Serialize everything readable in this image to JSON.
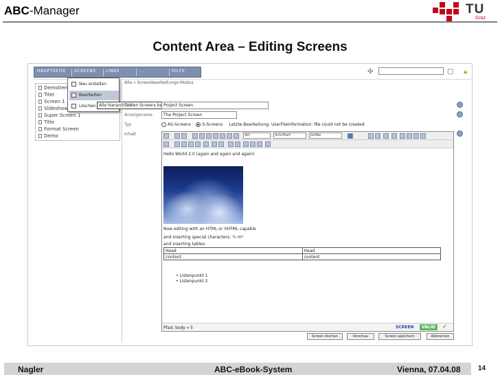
{
  "header": {
    "app_title_bold": "ABC",
    "app_title_rest": "-Manager",
    "logo_text": "TU",
    "logo_subtext": "Graz",
    "logo_color": "#c4001a"
  },
  "slide": {
    "title": "Content Area – Editing Screens"
  },
  "screenshot": {
    "menubar": [
      "HAUPTSEITE",
      "SCREENS",
      "LINKS",
      "...",
      "HILFE"
    ],
    "path": "Alle » Screenbearbeitungs-Modus",
    "left_list": [
      "Demoitem",
      "Titel",
      "Screen 1",
      "Slideshow",
      "Super Screen 1",
      "Title",
      "Format Screen",
      "Demo"
    ],
    "popup_menu": [
      "Neu erstellen",
      "Bearbeiten",
      "Löschen"
    ],
    "popup_tooltip": "Alle hierarchischen Screens bearbeiten",
    "fields": [
      {
        "label": "Titel",
        "value": "Project Screen"
      },
      {
        "label": "Anzeigename",
        "value": "The Project Screen"
      },
      {
        "label": "Typ",
        "value": ""
      },
      {
        "label": "Inhalt",
        "value": ""
      }
    ],
    "radio_options": [
      "AS-Screens",
      "S-Screens"
    ],
    "radio_note": "Letzte Bearbeitung: UserFileInformation: file could not be created",
    "toolbar_selects": [
      "Stil",
      "Schriftart",
      "Größe"
    ],
    "editor_lines": [
      "Hello World 2.0 (again and again and again)",
      "Now editing with an HTML or XHTML capable",
      "and inserting special characters: ½ m²",
      "and inserting tables:"
    ],
    "table_rows": [
      [
        "Head",
        "Head"
      ],
      [
        "content",
        "content"
      ]
    ],
    "bullets": [
      "• Listenpunkt 1",
      "• Listenpunkt 2"
    ],
    "status_path": "Pfad: body » li",
    "status_screen": "SCREEN",
    "status_valid": "VALID",
    "status_check": "✓",
    "bottom_buttons": [
      "Screen löschen",
      "Vorschau",
      "Screen speichern",
      "Abbrechen"
    ]
  },
  "footer": {
    "author": "Nagler",
    "system": "ABC-eBook-System",
    "place_date": "Vienna, 07.04.08",
    "page": "14"
  }
}
